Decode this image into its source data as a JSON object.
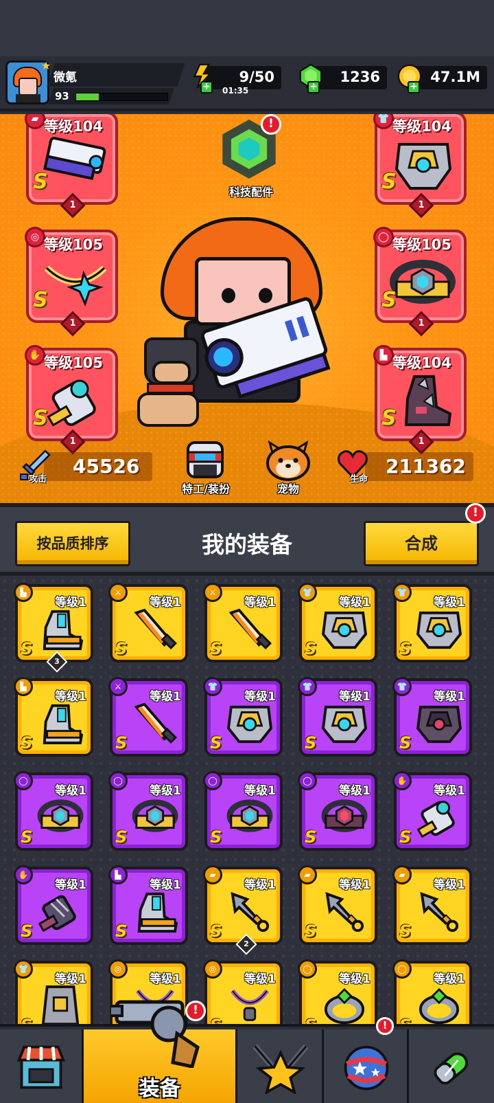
{
  "player": {
    "name": "微氪",
    "level": "93",
    "xp_fraction": 0.25
  },
  "resources": {
    "energy": "9/50",
    "energy_timer": "01:35",
    "gems": "1236",
    "gold": "47.1M"
  },
  "hero": {
    "tech_part_label": "科技配件",
    "tech_alert": "!",
    "attack_label": "攻击",
    "attack_value": "45526",
    "hp_label": "生命",
    "hp_value": "211362",
    "agent_label": "特工/装扮",
    "pet_label": "宠物",
    "slots_left": [
      {
        "level": "等级104",
        "rank": "S",
        "count": "1",
        "icon": "gun-slot-icon"
      },
      {
        "level": "等级105",
        "rank": "S",
        "count": "1",
        "icon": "necklace-slot-icon"
      },
      {
        "level": "等级105",
        "rank": "S",
        "count": "1",
        "icon": "glove-slot-icon"
      }
    ],
    "slots_right": [
      {
        "level": "等级104",
        "rank": "S",
        "count": "1",
        "icon": "armor-slot-icon"
      },
      {
        "level": "等级105",
        "rank": "S",
        "count": "1",
        "icon": "belt-slot-icon"
      },
      {
        "level": "等级104",
        "rank": "S",
        "count": "1",
        "icon": "boot-slot-icon"
      }
    ]
  },
  "inventory": {
    "sort_button": "按品质排序",
    "title": "我的装备",
    "merge_button": "合成",
    "merge_alert": "!",
    "items": [
      {
        "level": "等级1",
        "rank": "S",
        "quality": "gold",
        "type": "boots",
        "badge": "3"
      },
      {
        "level": "等级1",
        "rank": "S",
        "quality": "gold",
        "type": "blade",
        "badge": ""
      },
      {
        "level": "等级1",
        "rank": "S",
        "quality": "gold",
        "type": "blade",
        "badge": ""
      },
      {
        "level": "等级1",
        "rank": "S",
        "quality": "gold",
        "type": "armor",
        "badge": ""
      },
      {
        "level": "等级1",
        "rank": "S",
        "quality": "gold",
        "type": "armor",
        "badge": ""
      },
      {
        "level": "等级1",
        "rank": "S",
        "quality": "gold",
        "type": "boots",
        "badge": ""
      },
      {
        "level": "等级1",
        "rank": "S",
        "quality": "purple",
        "type": "blade",
        "badge": ""
      },
      {
        "level": "等级1",
        "rank": "S",
        "quality": "purple",
        "type": "armor",
        "badge": ""
      },
      {
        "level": "等级1",
        "rank": "S",
        "quality": "purple",
        "type": "armor",
        "badge": ""
      },
      {
        "level": "等级1",
        "rank": "S",
        "quality": "purple",
        "type": "dark-armor",
        "badge": ""
      },
      {
        "level": "等级1",
        "rank": "S",
        "quality": "purple",
        "type": "belt",
        "badge": ""
      },
      {
        "level": "等级1",
        "rank": "S",
        "quality": "purple",
        "type": "belt",
        "badge": ""
      },
      {
        "level": "等级1",
        "rank": "S",
        "quality": "purple",
        "type": "belt",
        "badge": ""
      },
      {
        "level": "等级1",
        "rank": "S",
        "quality": "purple",
        "type": "dark-belt",
        "badge": ""
      },
      {
        "level": "等级1",
        "rank": "S",
        "quality": "purple",
        "type": "glove",
        "badge": ""
      },
      {
        "level": "等级1",
        "rank": "S",
        "quality": "purple",
        "type": "dark-glove",
        "badge": ""
      },
      {
        "level": "等级1",
        "rank": "S",
        "quality": "purple",
        "type": "boots",
        "badge": ""
      },
      {
        "level": "等级1",
        "rank": "S",
        "quality": "gold",
        "type": "kunai",
        "badge": "2"
      },
      {
        "level": "等级1",
        "rank": "S",
        "quality": "gold",
        "type": "kunai",
        "badge": ""
      },
      {
        "level": "等级1",
        "rank": "S",
        "quality": "gold",
        "type": "kunai",
        "badge": ""
      },
      {
        "level": "等级1",
        "rank": "S",
        "quality": "gold",
        "type": "vest",
        "badge": ""
      },
      {
        "level": "等级1",
        "rank": "S",
        "quality": "gold",
        "type": "necklace",
        "badge": ""
      },
      {
        "level": "等级1",
        "rank": "S",
        "quality": "gold",
        "type": "necklace",
        "badge": ""
      },
      {
        "level": "等级1",
        "rank": "S",
        "quality": "gold",
        "type": "ring",
        "badge": ""
      },
      {
        "level": "等级1",
        "rank": "S",
        "quality": "gold",
        "type": "ring",
        "badge": ""
      }
    ]
  },
  "nav": {
    "equipment_label": "装备",
    "equipment_alert": "!",
    "world_alert": "!"
  },
  "colors": {
    "gold_card": "#ffd423",
    "purple_card": "#b943f6",
    "slot_red": "#ff5360",
    "hero_bg": "#ff9415"
  }
}
